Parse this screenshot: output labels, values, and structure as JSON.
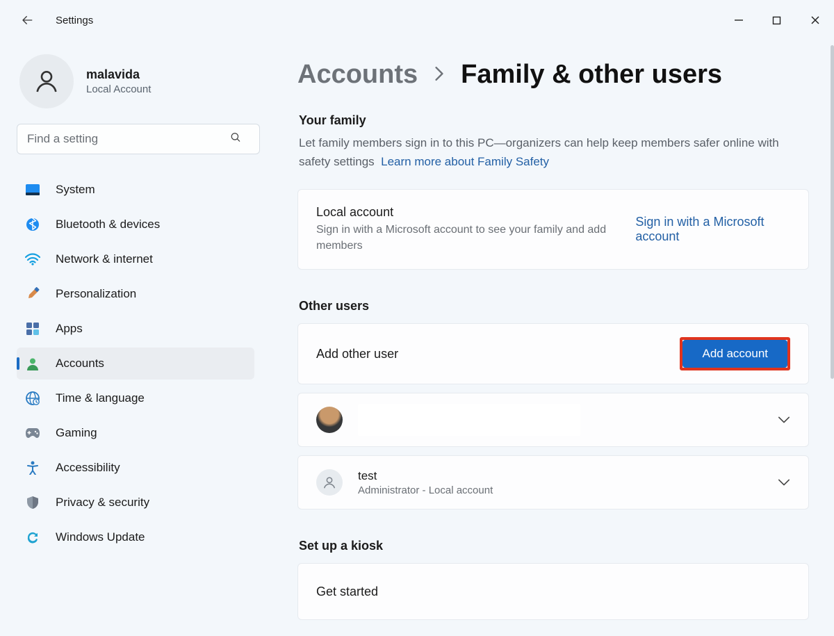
{
  "app_title": "Settings",
  "user": {
    "name": "malavida",
    "type": "Local Account"
  },
  "search": {
    "placeholder": "Find a setting"
  },
  "nav": {
    "items": [
      {
        "label": "System",
        "icon": "system-icon"
      },
      {
        "label": "Bluetooth & devices",
        "icon": "bluetooth-icon"
      },
      {
        "label": "Network & internet",
        "icon": "wifi-icon"
      },
      {
        "label": "Personalization",
        "icon": "paintbrush-icon"
      },
      {
        "label": "Apps",
        "icon": "apps-icon"
      },
      {
        "label": "Accounts",
        "icon": "person-icon",
        "selected": true
      },
      {
        "label": "Time & language",
        "icon": "globe-icon"
      },
      {
        "label": "Gaming",
        "icon": "gaming-icon"
      },
      {
        "label": "Accessibility",
        "icon": "accessibility-icon"
      },
      {
        "label": "Privacy & security",
        "icon": "shield-icon"
      },
      {
        "label": "Windows Update",
        "icon": "update-icon"
      }
    ]
  },
  "breadcrumb": {
    "parent": "Accounts",
    "current": "Family & other users"
  },
  "family": {
    "title": "Your family",
    "description": "Let family members sign in to this PC—organizers can help keep members safer online with safety settings",
    "link": "Learn more about Family Safety",
    "local": {
      "title": "Local account",
      "subtitle": "Sign in with a Microsoft account to see your family and add members",
      "action": "Sign in with a Microsoft account"
    }
  },
  "other": {
    "title": "Other users",
    "add": {
      "label": "Add other user",
      "button": "Add account",
      "highlight": "#e0341e",
      "button_bg": "#1769c6"
    },
    "users": [
      {
        "name": "",
        "subtitle": "",
        "avatar": "photo"
      },
      {
        "name": "test",
        "subtitle": "Administrator - Local account",
        "avatar": "placeholder"
      }
    ]
  },
  "kiosk": {
    "title": "Set up a kiosk",
    "action": "Get started"
  }
}
